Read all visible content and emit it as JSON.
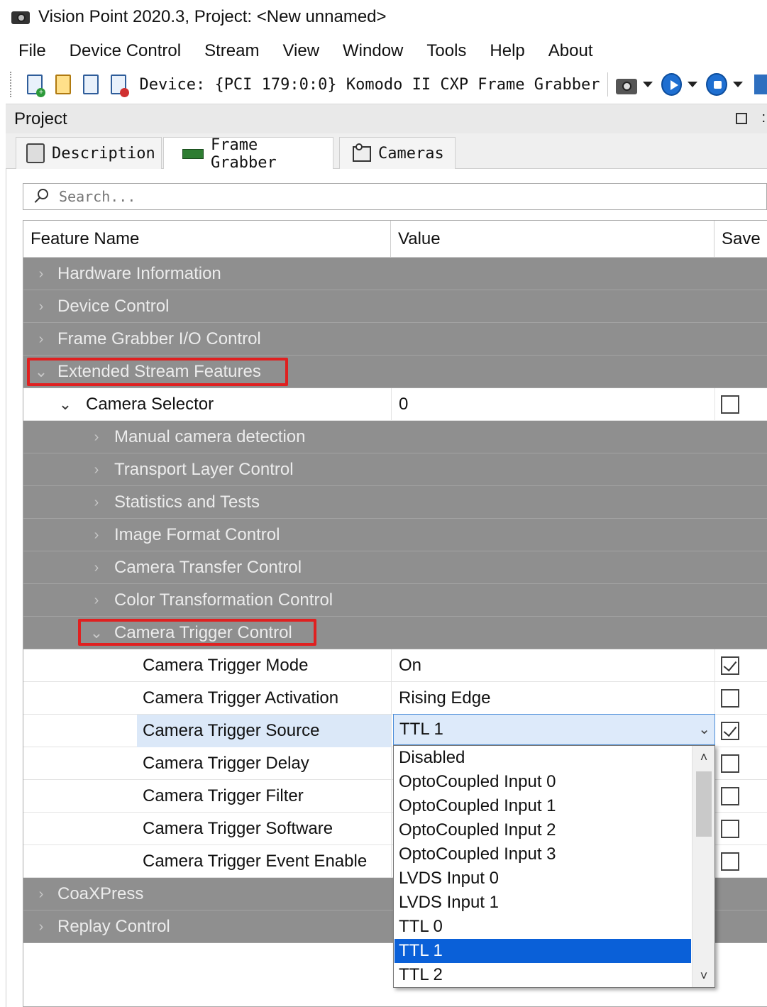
{
  "window": {
    "title": "Vision Point 2020.3, Project: <New unnamed>",
    "app_icon": "camera-icon"
  },
  "menu": [
    "File",
    "Device Control",
    "Stream",
    "View",
    "Window",
    "Tools",
    "Help",
    "About"
  ],
  "toolbar": {
    "device_label": "Device: {PCI 179:0:0} Komodo II CXP Frame Grabber",
    "icons": [
      "new-project-icon",
      "open-project-icon",
      "save-project-icon",
      "close-project-icon",
      "camera-icon",
      "play-icon",
      "stop-icon"
    ]
  },
  "project_panel": {
    "title": "Project"
  },
  "tabs": [
    {
      "label": "Description",
      "icon": "document-icon"
    },
    {
      "label": "Frame Grabber",
      "icon": "board-icon"
    },
    {
      "label": "Cameras",
      "icon": "cameras-icon"
    }
  ],
  "search": {
    "placeholder": "Search..."
  },
  "table": {
    "columns": [
      "Feature Name",
      "Value",
      "Save"
    ],
    "rows": [
      {
        "type": "group",
        "expanded": false,
        "level": 0,
        "name": "Hardware Information"
      },
      {
        "type": "group",
        "expanded": false,
        "level": 0,
        "name": "Device Control"
      },
      {
        "type": "group",
        "expanded": false,
        "level": 0,
        "name": "Frame Grabber I/O Control"
      },
      {
        "type": "group",
        "expanded": true,
        "level": 0,
        "name": "Extended Stream Features",
        "highlighted": true
      },
      {
        "type": "item",
        "expanded": true,
        "level": 1,
        "name": "Camera Selector",
        "value": "0",
        "save": false
      },
      {
        "type": "group",
        "expanded": false,
        "level": 2,
        "name": "Manual camera detection"
      },
      {
        "type": "group",
        "expanded": false,
        "level": 2,
        "name": "Transport Layer Control"
      },
      {
        "type": "group",
        "expanded": false,
        "level": 2,
        "name": "Statistics and Tests"
      },
      {
        "type": "group",
        "expanded": false,
        "level": 2,
        "name": "Image Format Control"
      },
      {
        "type": "group",
        "expanded": false,
        "level": 2,
        "name": "Camera Transfer Control"
      },
      {
        "type": "group",
        "expanded": false,
        "level": 2,
        "name": "Color Transformation Control"
      },
      {
        "type": "group",
        "expanded": true,
        "level": 2,
        "name": "Camera Trigger Control",
        "highlighted": true
      },
      {
        "type": "item",
        "level": 3,
        "name": "Camera Trigger Mode",
        "value": "On",
        "save": true
      },
      {
        "type": "item",
        "level": 3,
        "name": "Camera Trigger Activation",
        "value": "Rising Edge",
        "save": false
      },
      {
        "type": "item",
        "level": 3,
        "name": "Camera Trigger Source",
        "value": "TTL 1",
        "save": true,
        "selected": true,
        "editing": true
      },
      {
        "type": "item",
        "level": 3,
        "name": "Camera Trigger Delay",
        "value": "",
        "save": false
      },
      {
        "type": "item",
        "level": 3,
        "name": "Camera Trigger Filter",
        "value": "",
        "save": false
      },
      {
        "type": "item",
        "level": 3,
        "name": "Camera Trigger Software",
        "value": "",
        "save": false
      },
      {
        "type": "item",
        "level": 3,
        "name": "Camera Trigger Event Enable",
        "value": "",
        "save": false
      },
      {
        "type": "group",
        "expanded": false,
        "level": 0,
        "name": "CoaXPress"
      },
      {
        "type": "group",
        "expanded": false,
        "level": 0,
        "name": "Replay Control"
      }
    ]
  },
  "trigger_source_combo": {
    "current": "TTL 1",
    "options": [
      "Disabled",
      "OptoCoupled Input 0",
      "OptoCoupled Input 1",
      "OptoCoupled Input 2",
      "OptoCoupled Input 3",
      "LVDS Input 0",
      "LVDS Input 1",
      "TTL 0",
      "TTL 1",
      "TTL 2"
    ],
    "selected_index": 8
  },
  "colors": {
    "group_row": "#8f8f8f",
    "selection": "#0a60d8",
    "highlight_box": "#e02020"
  }
}
